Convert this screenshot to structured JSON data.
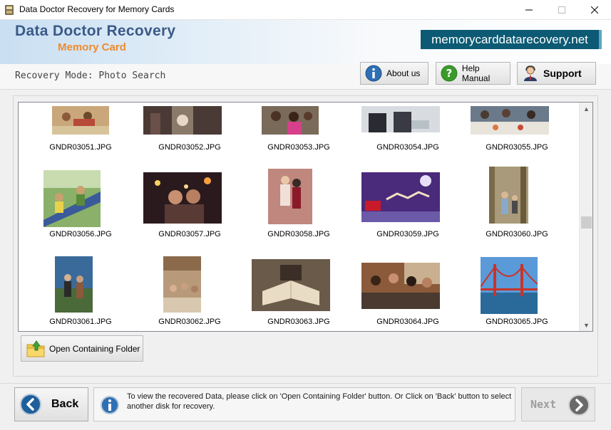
{
  "window": {
    "title": "Data Doctor Recovery for Memory Cards"
  },
  "header": {
    "brand_line1": "Data Doctor Recovery",
    "brand_line2": "Memory Card",
    "website": "memorycarddatarecovery.net"
  },
  "toolbar": {
    "mode_label": "Recovery Mode: Photo Search",
    "about_label": "About us",
    "help_label": "Help Manual",
    "support_label": "Support"
  },
  "files": [
    "GNDR03051.JPG",
    "GNDR03052.JPG",
    "GNDR03053.JPG",
    "GNDR03054.JPG",
    "GNDR03055.JPG",
    "GNDR03056.JPG",
    "GNDR03057.JPG",
    "GNDR03058.JPG",
    "GNDR03059.JPG",
    "GNDR03060.JPG",
    "GNDR03061.JPG",
    "GNDR03062.JPG",
    "GNDR03063.JPG",
    "GNDR03064.JPG",
    "GNDR03065.JPG"
  ],
  "actions": {
    "open_folder_label": "Open Containing Folder",
    "back_label": "Back",
    "next_label": "Next",
    "info_text": "To view the recovered Data, please click on 'Open Containing Folder' button. Or Click on 'Back' button to select another disk for recovery."
  },
  "colors": {
    "brand_blue": "#3b5a87",
    "brand_orange": "#f08a2c",
    "badge_bg": "#0c5a73",
    "icon_blue": "#2f6fb3",
    "icon_green": "#3a9a2a"
  }
}
